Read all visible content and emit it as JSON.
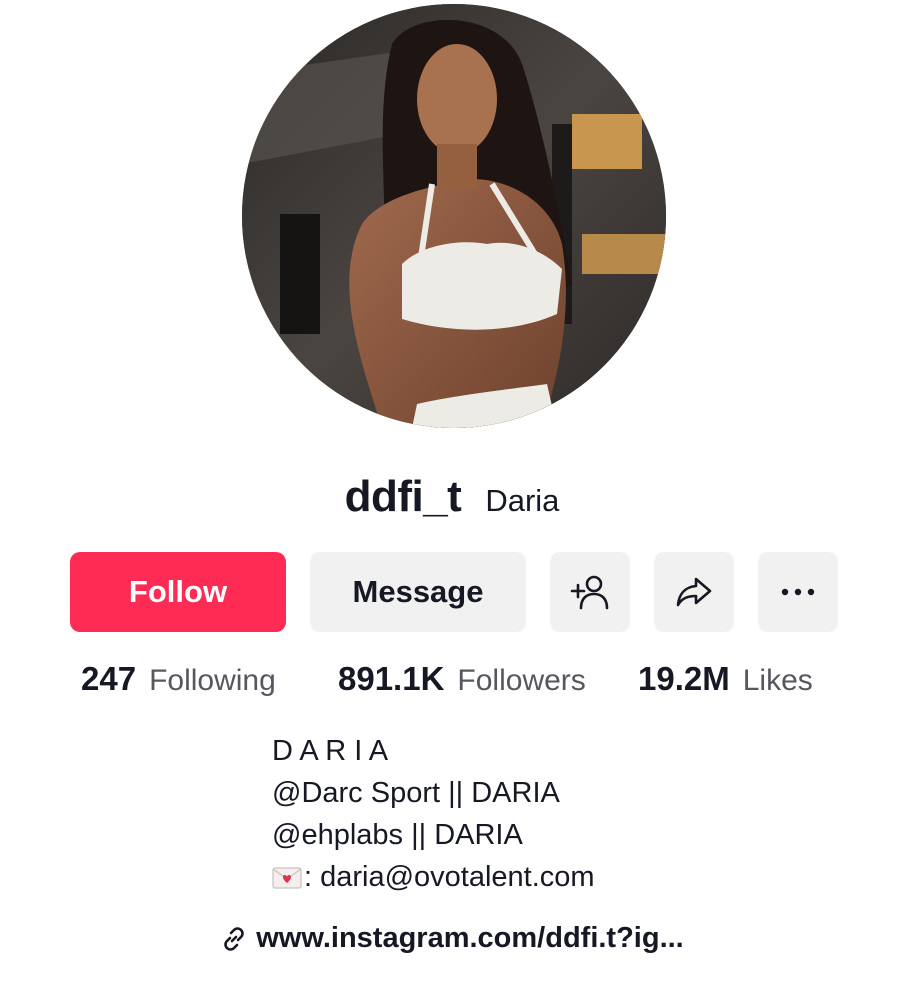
{
  "profile": {
    "username": "ddfi_t",
    "nickname": "Daria",
    "avatar_icon": "profile-photo"
  },
  "actions": {
    "follow_label": "Follow",
    "message_label": "Message",
    "add_friend_icon": "add-friend-icon",
    "share_icon": "share-icon",
    "more_icon": "more-icon"
  },
  "stats": {
    "following": {
      "value": "247",
      "label": "Following"
    },
    "followers": {
      "value": "891.1K",
      "label": "Followers"
    },
    "likes": {
      "value": "19.2M",
      "label": "Likes"
    }
  },
  "bio": {
    "lines": [
      "D A R I A",
      "@Darc Sport || DARIA",
      "@ehplabs || DARIA",
      ": daria@ovotalent.com"
    ],
    "envelope_icon": "love-letter-icon"
  },
  "link": {
    "text": "www.instagram.com/ddfi.t?ig...",
    "icon": "link-icon"
  },
  "colors": {
    "follow_bg": "#fe2c55",
    "button_bg": "#f1f1f2",
    "text_primary": "#161823",
    "text_secondary": "#57575f"
  }
}
